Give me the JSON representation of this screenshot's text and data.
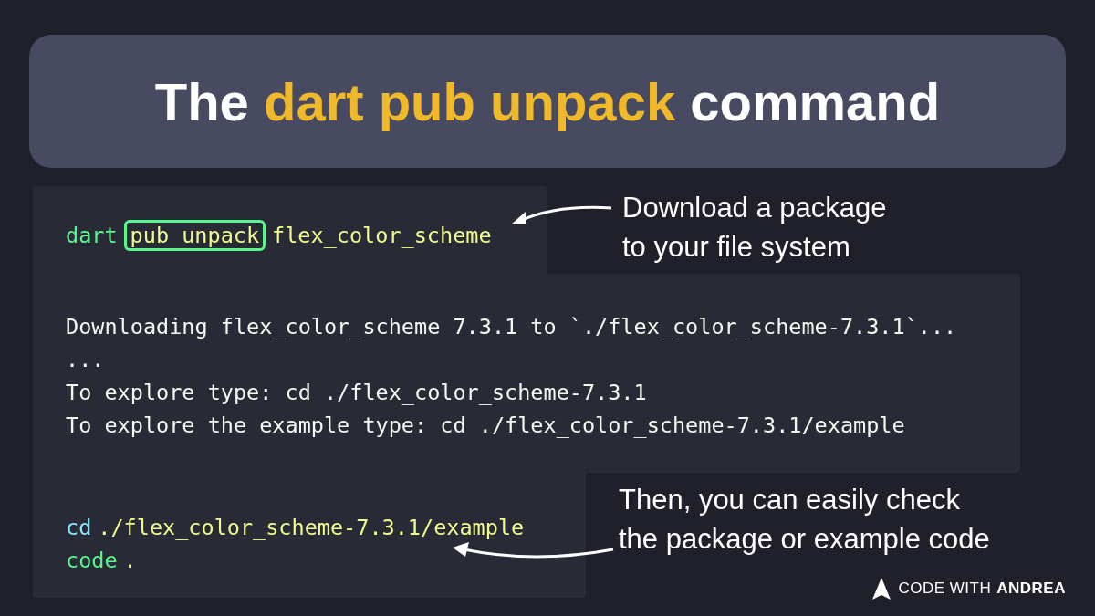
{
  "title": [
    {
      "text": "The ",
      "highlight": false
    },
    {
      "text": "dart pub unpack",
      "highlight": true
    },
    {
      "text": " command",
      "highlight": false
    }
  ],
  "panels": [
    {
      "lines": [
        [
          {
            "text": "dart",
            "color": "#5af78e",
            "boxed": false
          },
          {
            "text": "pub unpack",
            "color": "#f1fa8c",
            "boxed": true
          },
          {
            "text": "flex_color_scheme",
            "color": "#f1fa8c",
            "boxed": false
          }
        ]
      ],
      "note": {
        "lines": [
          "Download a package",
          "to your file system"
        ]
      }
    },
    {
      "lines": [
        [
          {
            "text": "Downloading flex_color_scheme 7.3.1 to `./flex_color_scheme-7.3.1`...",
            "color": "#f8f8f2",
            "boxed": false
          }
        ],
        [
          {
            "text": "...",
            "color": "#f8f8f2",
            "boxed": false
          }
        ],
        [
          {
            "text": "To explore type: cd ./flex_color_scheme-7.3.1",
            "color": "#f8f8f2",
            "boxed": false
          }
        ],
        [
          {
            "text": "To explore the example type: cd ./flex_color_scheme-7.3.1/example",
            "color": "#f8f8f2",
            "boxed": false
          }
        ]
      ]
    },
    {
      "lines": [
        [
          {
            "text": "cd",
            "color": "#8be9fd",
            "boxed": false
          },
          {
            "text": "./flex_color_scheme-7.3.1/example",
            "color": "#f1fa8c",
            "boxed": false
          }
        ],
        [
          {
            "text": "code",
            "color": "#5af78e",
            "boxed": false
          },
          {
            "text": ".",
            "color": "#f1fa8c",
            "boxed": false
          }
        ]
      ],
      "note": {
        "lines": [
          "Then, you can easily check",
          "the package or example code"
        ]
      }
    }
  ],
  "logo": {
    "light": "CODE WITH",
    "bold": "ANDREA"
  }
}
